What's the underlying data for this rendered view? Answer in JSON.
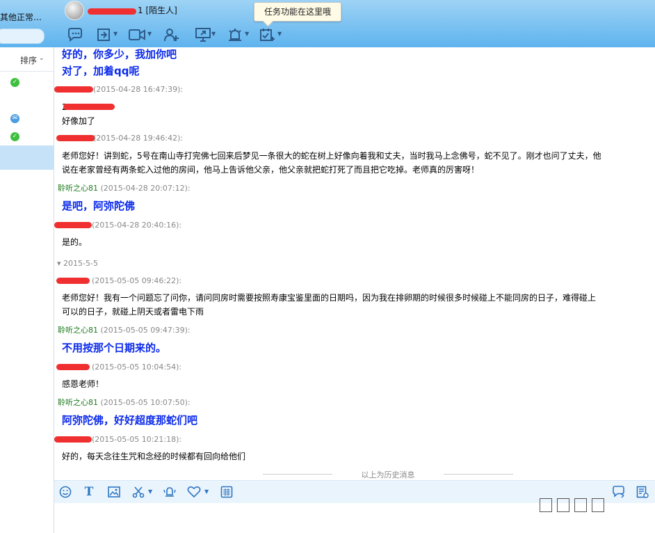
{
  "window": {
    "left_status": "其他正常…",
    "contact_tag": "1 [陌生人]",
    "tooltip": "任务功能在这里哦"
  },
  "toolbar_icons": [
    "chat-icon",
    "transfer-file-icon",
    "video-call-icon",
    "add-friend-icon",
    "remote-desktop-icon",
    "alarm-icon",
    "task-icon"
  ],
  "sidebar": {
    "sort_label": "排序"
  },
  "colors": {
    "accent_blue": "#0b2aeb",
    "sender_green": "#1e7a1e",
    "redaction": "#f03030",
    "toolbar_top": "#9ed3f5",
    "toolbar_bottom": "#5eb3ee"
  },
  "messages": [
    {
      "kind": "reply",
      "text": "好的，你多少，我加你吧"
    },
    {
      "kind": "reply",
      "text": "对了，加着qq呢"
    },
    {
      "kind": "sender",
      "name": "",
      "time": "(2015-04-28 16:47:39):"
    },
    {
      "kind": "text",
      "text": "2"
    },
    {
      "kind": "text",
      "text": "好像加了"
    },
    {
      "kind": "sender",
      "name": "",
      "time": "(2015-04-28 19:46:42):"
    },
    {
      "kind": "text",
      "text": "老师您好！讲到蛇，5号在南山寺打完佛七回来后梦见一条很大的蛇在树上好像向着我和丈夫，当时我马上念佛号，蛇不见了。刚才也问了丈夫，他"
    },
    {
      "kind": "text",
      "text": "说在老家曾经有两条蛇入过他的房间，他马上告诉他父亲，他父亲就把蛇打死了而且把它吃掉。老师真的厉害呀！"
    },
    {
      "kind": "sender",
      "name": "聆听之心81",
      "time": "(2015-04-28 20:07:12):"
    },
    {
      "kind": "reply",
      "text": "是吧，阿弥陀佛"
    },
    {
      "kind": "sender",
      "name": "",
      "time": "(2015-04-28 20:40:16):"
    },
    {
      "kind": "text",
      "text": "是的。"
    },
    {
      "kind": "date",
      "text": "2015-5-5"
    },
    {
      "kind": "sender",
      "name": "",
      "time": "(2015-05-05 09:46:22):"
    },
    {
      "kind": "text",
      "text": "老师您好！我有一个问题忘了问你，请问同房时需要按照寿康宝鉴里面的日期吗，因为我在排卵期的时候很多时候碰上不能同房的日子，难得碰上"
    },
    {
      "kind": "text",
      "text": "可以的日子，就碰上阴天或者雷电下雨"
    },
    {
      "kind": "sender",
      "name": "聆听之心81",
      "time": "(2015-05-05 09:47:39):"
    },
    {
      "kind": "reply",
      "text": "不用按那个日期来的。"
    },
    {
      "kind": "sender",
      "name": "",
      "time": "(2015-05-05 10:04:54):"
    },
    {
      "kind": "text",
      "text": "感恩老师！"
    },
    {
      "kind": "sender",
      "name": "聆听之心81",
      "time": "(2015-05-05 10:07:50):"
    },
    {
      "kind": "reply",
      "text": "阿弥陀佛，好好超度那蛇们吧"
    },
    {
      "kind": "sender",
      "name": "",
      "time": "(2015-05-05 10:21:18):"
    },
    {
      "kind": "text",
      "text": "好的，每天念往生咒和念经的时候都有回向给他们"
    }
  ],
  "history_label": "以上为历史消息",
  "input_toolbar_icons": [
    "emoji-icon",
    "font-icon",
    "image-icon",
    "screenshot-icon",
    "shake-icon",
    "gift-icon",
    "quick-reply-icon",
    "message-history-icon",
    "records-icon"
  ]
}
